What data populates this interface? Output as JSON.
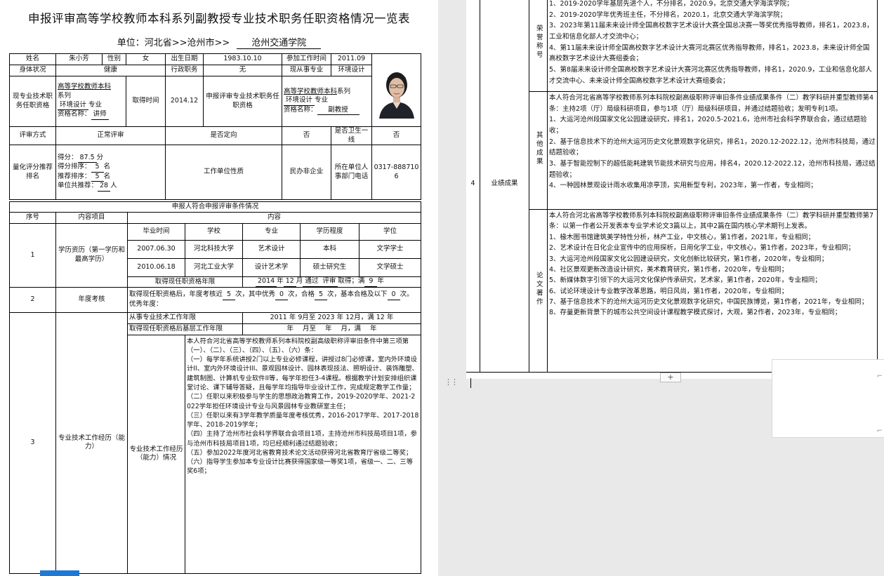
{
  "doc": {
    "title": "申报评审高等学校教师本科系列副教授专业技术职务任职资格情况一览表",
    "unit_prefix": "单位：河北省>>沧州市>>",
    "unit_name": "沧州交通学院"
  },
  "info": {
    "name_label": "姓名",
    "name": "朱小芳",
    "gender_label": "性别",
    "gender": "女",
    "birth_label": "出生日期",
    "birth": "1983.10.10",
    "work_label": "参加工作时间",
    "work": "2011.09",
    "health_label": "身体状况",
    "health": "健康",
    "admin_label": "行政职务",
    "admin": "无",
    "major_label": "现从事专业",
    "major": "环境设计",
    "cur_label": "现专业技术职务任职资格",
    "cur_series": "高等学校教师本科",
    "cur_series_suffix": "系列",
    "cur_major": "环境设计",
    "cur_major_suffix": "专业",
    "cur_qual_prefix": "资格名称：",
    "cur_qual": "讲师",
    "get_label": "取得时间",
    "get_time": "2014.12",
    "apply_label": "申报评审专业技术职务任职资格",
    "apply_series": "高等学校教师本科",
    "apply_series_suffix": "系列",
    "apply_major": "环境设计",
    "apply_major_suffix": "专业",
    "apply_qual_prefix": "资格名称：",
    "apply_qual": "副教授",
    "method_label": "评审方式",
    "method": "正常评审",
    "directed_label": "是否定向",
    "directed": "否",
    "health1_label": "是否卫生一线",
    "health1": "否",
    "score_label": "量化评分推荐排名",
    "score_prefix": "得分：",
    "score": "87.5",
    "score_unit": "分",
    "rank_prefix": "得分排序：",
    "rank": "5",
    "rank_unit": "名",
    "rec_prefix": "推荐排序：",
    "rec": "5",
    "rec_unit": "名",
    "total_prefix": "单位共推荐：",
    "total": "28",
    "total_unit": "人",
    "nature_label": "工作单位性质",
    "nature": "民办非企业",
    "phone_label": "所在单位人事部门电话",
    "phone": "0317-8887106"
  },
  "cond": {
    "header": "申报人符合申报评审条件情况",
    "col_no": "序号",
    "col_item": "内容项目",
    "col_content": "内容",
    "r1_no": "1",
    "r1_item": "学历资历（第一学历和最高学历）",
    "edu_headers": [
      "毕业时间",
      "学校",
      "专业",
      "学历程度",
      "学位"
    ],
    "edu_rows": [
      [
        "2007.06.30",
        "河北科技大学",
        "艺术设计",
        "本科",
        "文学学士"
      ],
      [
        "2010.06.18",
        "河北工业大学",
        "设计艺术学",
        "硕士研究生",
        "文学硕士"
      ]
    ],
    "years_label": "取得现任职资格年限",
    "years_a": "2014",
    "years_b": "年",
    "years_c": "12",
    "years_d": "月",
    "years_e": "通过",
    "years_f": "评审",
    "years_g": "取得；满",
    "years_h": "9",
    "years_i": "年",
    "r2_no": "2",
    "r2_item": "年度考核",
    "r2_a": "取得现任职资格后，年度考核近",
    "r2_b": "5",
    "r2_c": "次，其中优秀",
    "r2_d": "0",
    "r2_e": "次，合格",
    "r2_f": "5",
    "r2_g": "次，基本合格及以下",
    "r2_h": "0",
    "r2_i": "次。优秀年度：",
    "r3_no": "3",
    "r3_item": "专业技术工作经历（能力）",
    "r3_years_label": "从事专业技术工作年限",
    "r3_years": "2011 年 9月至 2023 年 12月，满 12 年",
    "r3_grass_label": "取得现任职资格后基层工作年限",
    "r3_grass": "年 月至 年 月，满 年",
    "r3_sub": "专业技术工作经历（能力）情况",
    "r3_paras": [
      "本人符合河北省高等学校教师系列本科院校副高级职称评审旧条件中第三项第（一）、（二）、（三）、（四）、（五）、（六）条：",
      "（一）每学年系统讲授2门以上专业必修课程，讲授过8门必修课，室内外环境设计II、室内外环境设计III、景观园林设计、园林表现技法、照明设计、装饰雕塑、建筑制图、计算机专业软件II等，每学年担任3-4课程。根据教学计划安排组织课堂讨论、课下辅导答疑，且每学年均指导毕业设计工作，完成规定教学工作量；",
      "（二）任职以来积极参与学生的思想政治教育工作，2019-2020学年、2021-2022学年担任环境设计专业与风景园林专业教研室主任；",
      "（三）任职以来有3学年教学质量年度考核优秀，2016-2017学年、2017-2018学年、2018-2019学年；",
      "（四）主持了沧州市社会科学界联合会项目1项，主持沧州市科技局项目1项，参与沧州市科技局项目1项，均已经顺利通过结题验收；",
      "（五）参加2022年度河北省教育技术论文活动获得河北省教育厅省级二等奖；",
      "（六）指导学生参加本专业设计比赛获得国家级一等奖1项，省级一、二、三等奖6项；"
    ],
    "r4_no": "4",
    "r4_item": "业绩成果",
    "honor_label": "荣誉称号",
    "honor_lines": [
      "1、2019-2020学年基层先进个人，不分排名，2020.9，北京交通大学海滨学院；",
      "2、2019-2020学年优秀班主任，不分排名，2020.1，北京交通大学海滨学院；",
      "3、2023年第11届未来设计师全国高校数字艺术设计大赛全国总决赛一等奖优秀指导教师，排名1，2023.8，工业和信息化部人才交流中心；",
      "4、第11届未来设计师全国高校数字艺术设计大赛河北赛区优秀指导教师，排名1，2023.8，未来设计师全国高校数字艺术设计大赛组委会；",
      "5、第8届未来设计师全国高校数字艺术设计大赛河北赛区优秀指导教师，排名1，2020.9，工业和信息化部人才交流中心、未来设计师全国高校数字艺术设计大赛组委会；"
    ],
    "other_label": "其他成果",
    "other_lines": [
      "本人符合河北省高等学校教师系列本科院校副高级职称评审旧条件业绩成果条件（二）教学科研并重型教师第4条：主持2项（厅）局级科研项目，参与1项（厅）局级科研项目，并通过结题验收；发明专利1项。",
      "1、大运河沧州段国家文化公园建设研究，排名1，2020.5-2021.6，沧州市社会科学界联合会，通过结题验收；",
      "2、基于信息技术下的沧州大运河历史文化景观数字化研究，排名1，2020.12-2022.12，沧州市科技局，通过结题验收；",
      "3、基于智能控制下的超低能耗建筑节能技术研究与应用，排名4，2020.12-2022.12，沧州市科技局，通过结题验收；",
      "4、一种园林景观设计雨水收集用凉亭顶，实用新型专利，2023年，第一作者，专业相同；"
    ],
    "paper_label": "论文著作",
    "paper_lines": [
      "本人符合河北省高等学校教师系列本科院校副高级职称评审旧条件业绩成果条件（二）教学科研并重型教师第7条：以第一作者公开发表本专业学术论文3篇以上，其中2篇在国内核心学术期刊上发表。",
      "1、椽木图书馆建筑美学特性分析，林产工业，中文核心，第1作者，2021年，专业相同；",
      "2、艺术设计在日化企业宣传中的应用探析，日用化学工业，中文核心，第1作者，2023年，专业相同；",
      "3、大运河沧州段国家文化公园建设研究，文化创新比较研究，第1作者，2020年，专业相同；",
      "4、社区景观更新改造设计研究，美术教育研究，第1作者，2020年，专业相同；",
      "5、新媒体数字引领下的大运河文化保护传承研究，艺术家，第1作者，2020年，专业相同；",
      "6、试论环境设计专业教学改革思路，明日风尚，第1作者，2020年，专业相同；",
      "7、基于信息技术下的沧州大运河历史文化景观数字化研究，中国民族博览，第1作者，2021年，专业相同；",
      "8、存量更新背景下的城市公共空间设计课程教学模式探讨，大观，第2作者，2023年，专业相同；"
    ]
  },
  "ui": {
    "add_button": "+",
    "grip": "⋮⋮"
  },
  "colors": {
    "accent": "#1e78d6",
    "page_bg": "#ffffff",
    "canvas_bg": "#e9e9e9"
  }
}
